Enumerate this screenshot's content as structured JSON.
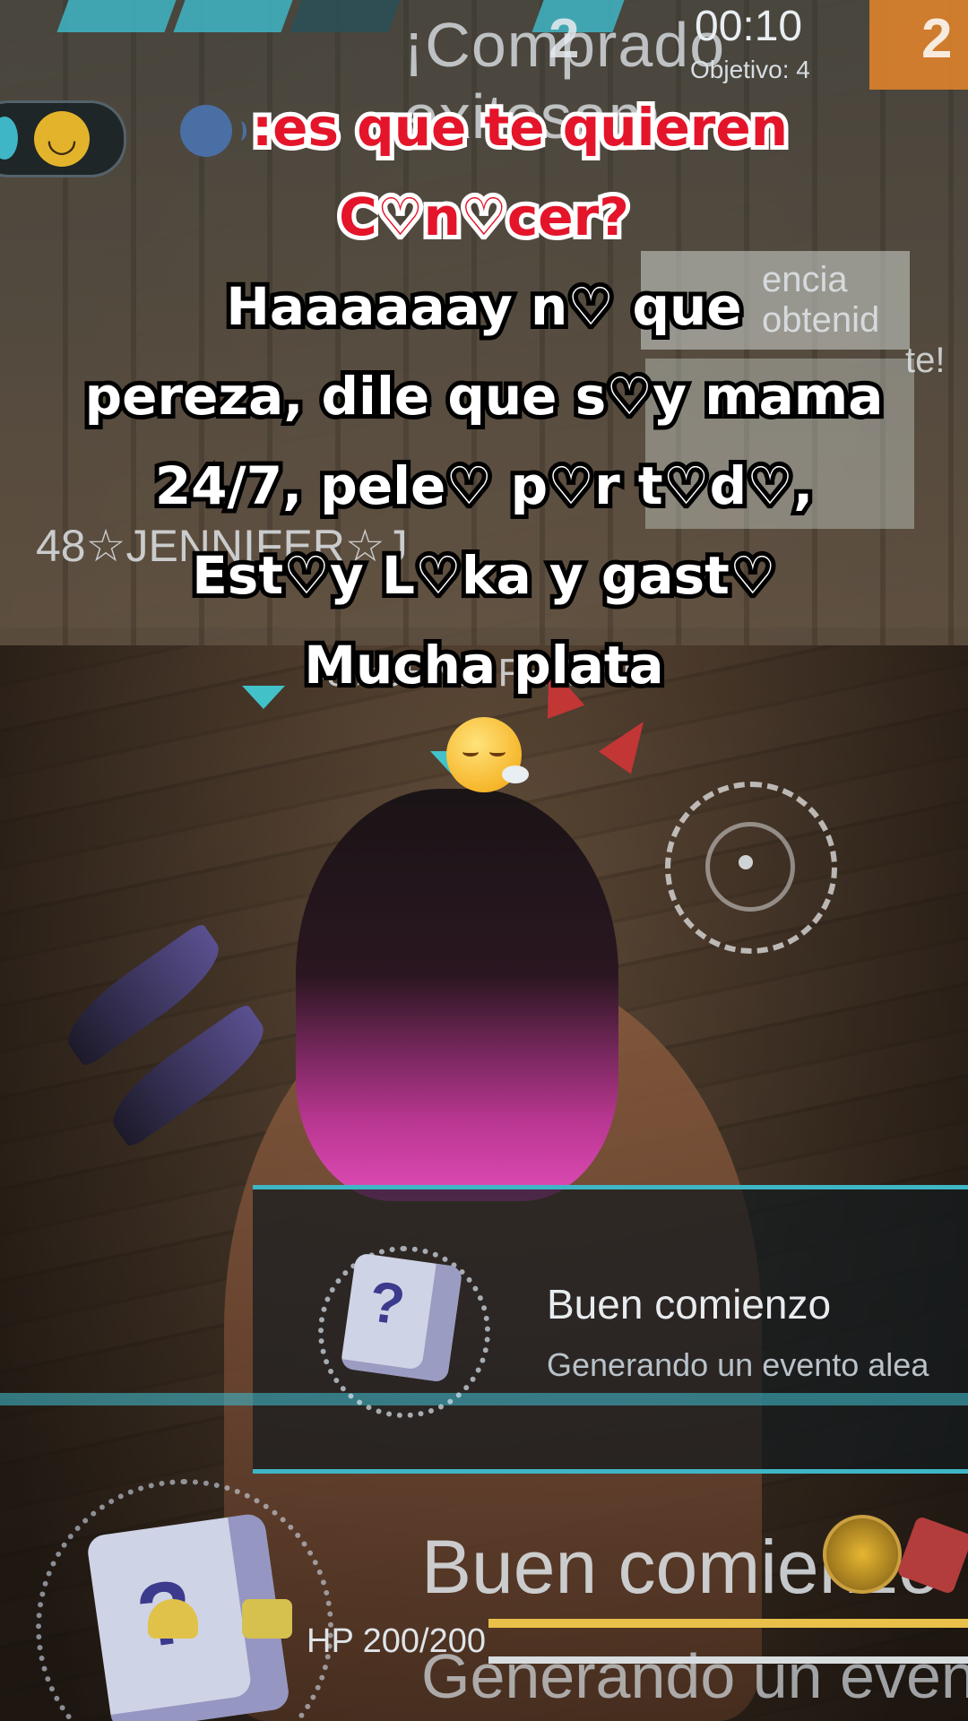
{
  "hud": {
    "banner_text": "¡Comprado exitosam",
    "timer": "00:10",
    "objective": "Objetivo: 4",
    "score_left": "2",
    "score_right": "2",
    "bg_text_right": "encia obtenid",
    "bg_text_right2": "te!",
    "bg_player_tag": "48☆JENNIFER☆J",
    "bg_player_tag_small": "48☆JENNIFER☆J"
  },
  "caption": {
    "line1": ":es que te quieren",
    "line2": "C♡n♡cer?",
    "line3": "Haaaaaay n♡ que",
    "line4": "pereza, dile que s♡y mama",
    "line5": "24/7, pele♡ p♡r t♡d♡,",
    "line6": "Est♡y L♡ka y gast♡",
    "line7": "Mucha plata",
    "speaker_icon": "speaking-head-icon",
    "end_emoji": "exhausted-face-icon"
  },
  "notification": {
    "title": "Buen comienzo",
    "subtitle": "Generando un evento alea"
  },
  "bottom_hud": {
    "title": "Buen comienzo",
    "subtitle": "Generando un evento",
    "hp": "HP 200/200",
    "hp_fraction": 1.0
  },
  "colors": {
    "accent_teal": "#3fb6c6",
    "caption_red": "#e4152a",
    "hp_yellow": "#e8c04a"
  }
}
